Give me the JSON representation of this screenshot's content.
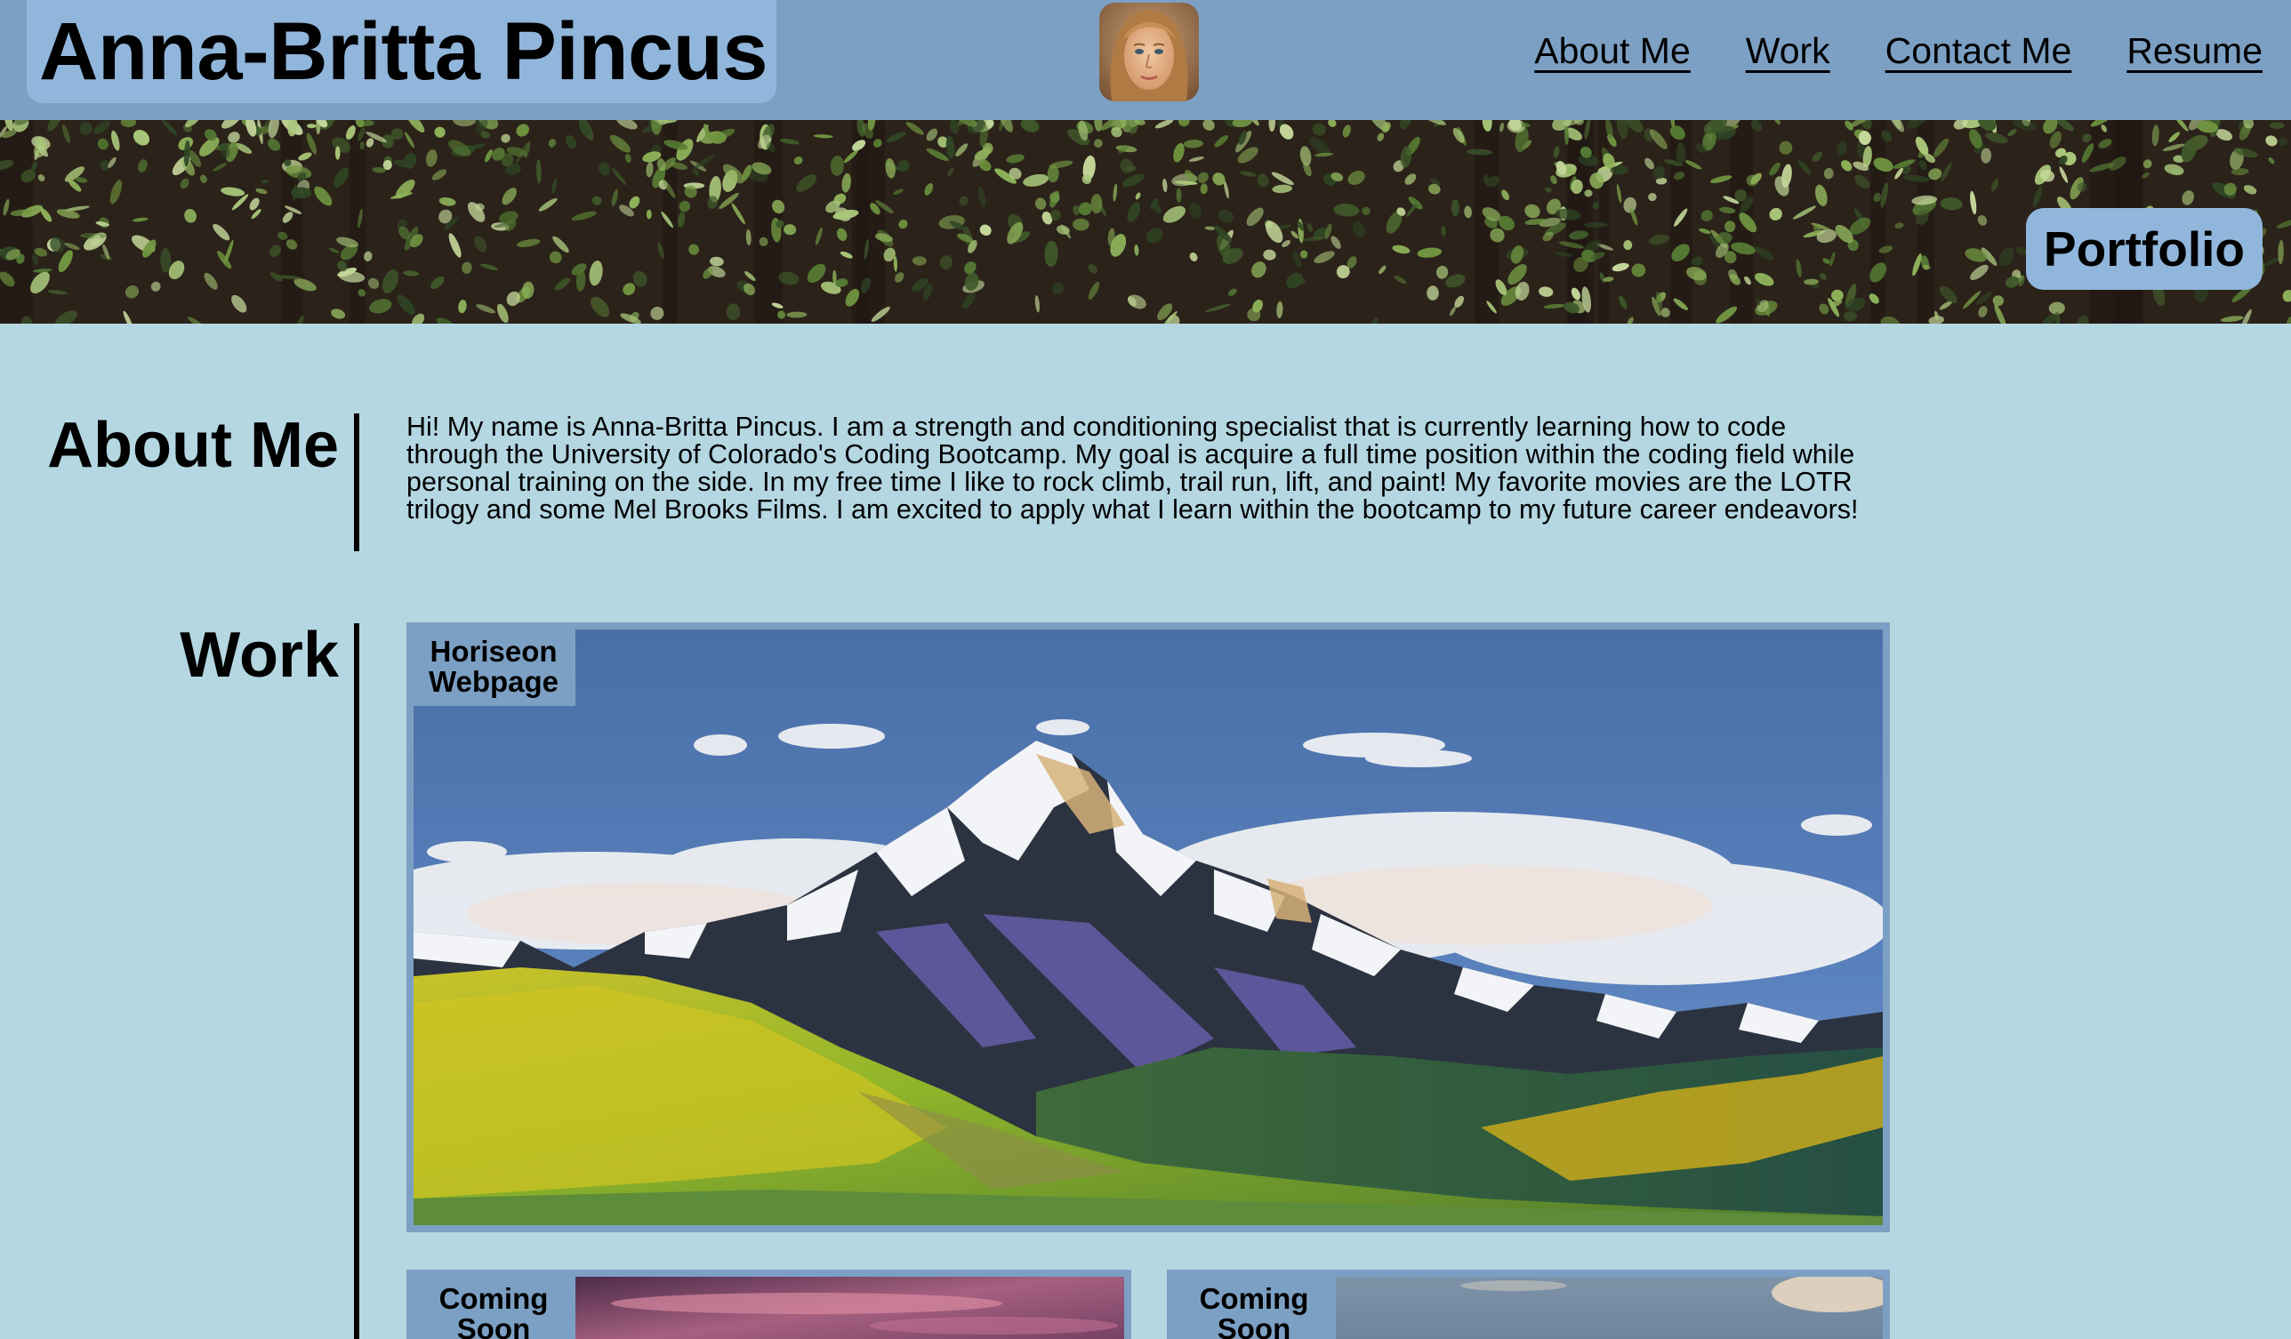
{
  "header": {
    "name": "Anna-Britta Pincus",
    "nav": [
      {
        "label": "About Me"
      },
      {
        "label": "Work"
      },
      {
        "label": "Contact Me"
      },
      {
        "label": "Resume"
      }
    ]
  },
  "hero": {
    "badge": "Portfolio"
  },
  "about": {
    "heading": "About Me",
    "text": "Hi! My name is Anna-Britta Pincus. I am a strength and conditioning specialist that is currently learning how to code through the University of Colorado's Coding Bootcamp. My goal is acquire a full time position within the coding field while personal training on the side. In my free time I like to rock climb, trail run, lift, and paint! My favorite movies are the LOTR trilogy and some Mel Brooks Films. I am excited to apply what I learn within the bootcamp to my future career endeavors!"
  },
  "work": {
    "heading": "Work",
    "projects": [
      {
        "label": "Horiseon Webpage"
      },
      {
        "label": "Coming Soon"
      },
      {
        "label": "Coming Soon"
      }
    ]
  },
  "colors": {
    "page_background": "#b4d7e2",
    "header_background": "#7ca0c4",
    "accent_box": "#91b6dc"
  }
}
